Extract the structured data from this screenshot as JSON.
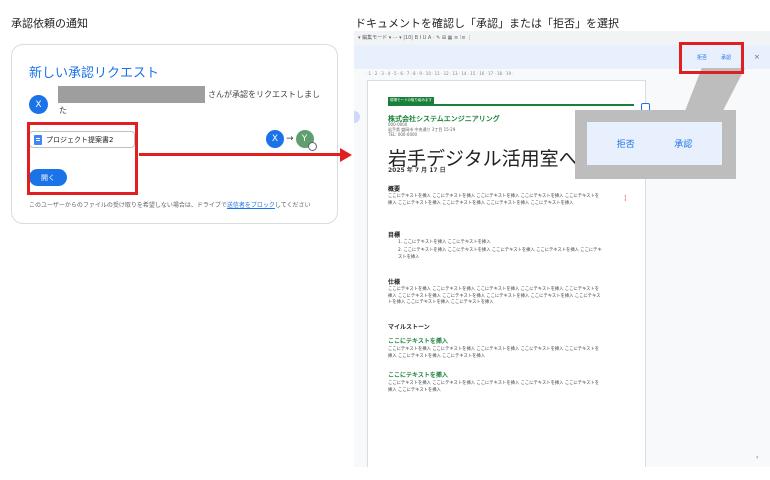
{
  "captions": {
    "left": "承認依頼の通知",
    "right": "ドキュメントを確認し「承認」または「拒否」を選択"
  },
  "email_card": {
    "title": "新しい承認リクエスト",
    "avatar_letter": "X",
    "request_text_line1": "さんが承認をリクエストしまし",
    "request_text_line2": "た",
    "file_name": "プロジェクト提案書2",
    "from_avatar": "X",
    "to_avatar": "Y",
    "open_button": "開く",
    "footer_prefix": "このユーザーからのファイルの受け取りを希望しない場合は、ドライブで",
    "footer_link": "送信者をブロック",
    "footer_suffix": "してください"
  },
  "editor": {
    "toolbar_text": "▾ 編集モード ▾   ··· ▾  |10|  B  I  U  A  ·  ✎  ⊞  ▦  ≡  ⁝≡  ⋮",
    "reject_label": "拒否",
    "approve_label": "承認",
    "ruler_text": "· 1 · 2 · 3 · 4 · 5 · 6 · 7 · 8 · 9 · 10 · 11 · 12 · 13 · 14 · 15 · 16 · 17 · 18 · 19 ·",
    "document": {
      "badge": "現場モードの取り組みます",
      "company": "株式会社システムエンジニアリング",
      "address1": "000-0000",
      "address2": "岩手県 盛岡市 中央通り 3丁目 15-29",
      "address3": "TEL: 000-0000",
      "title": "岩手デジタル活用室への提",
      "date": "2025 年 7 月 17 日",
      "sections": {
        "overview_heading": "概要",
        "overview_text": "ここにテキストを挿入 ここにテキストを挿入 ここにテキストを挿入 ここにテキストを挿入 ここにテキストを挿入 ここにテキストを挿入 ここにテキストを挿入 ここにテキストを挿入 ここにテキストを挿入",
        "goals_heading": "目標",
        "goal1": "1.  ここにテキストを挿入 ここにテキストを挿入",
        "goal2": "2.  ここにテキストを挿入 ここにテキストを挿入 ここにテキストを挿入 ここにテキストを挿入 ここにテキストを挿入",
        "spec_heading": "仕様",
        "spec_text": "ここにテキストを挿入 ここにテキストを挿入 ここにテキストを挿入 ここにテキストを挿入 ここにテキストを挿入 ここにテキストを挿入 ここにテキストを挿入 ここにテキストを挿入 ここにテキストを挿入 ここにテキストを挿入 ここにテキストを挿入 ここにテキストを挿入",
        "milestone_heading": "マイルストーン",
        "sub1_heading": "ここにテキストを挿入",
        "sub1_text": "ここにテキストを挿入 ここにテキストを挿入 ここにテキストを挿入 ここにテキストを挿入 ここにテキストを挿入 ここにテキストを挿入 ここにテキストを挿入",
        "sub2_heading": "ここにテキストを挿入",
        "sub2_text": "ここにテキストを挿入 ここにテキストを挿入 ここにテキストを挿入 ここにテキストを挿入 ここにテキストを挿入 ここにテキストを挿入"
      }
    }
  },
  "zoom_callout": {
    "reject_label": "拒否",
    "approve_label": "承認"
  },
  "colors": {
    "accent_blue": "#1a73e8",
    "highlight_red": "#e02020",
    "doc_green": "#188038"
  }
}
